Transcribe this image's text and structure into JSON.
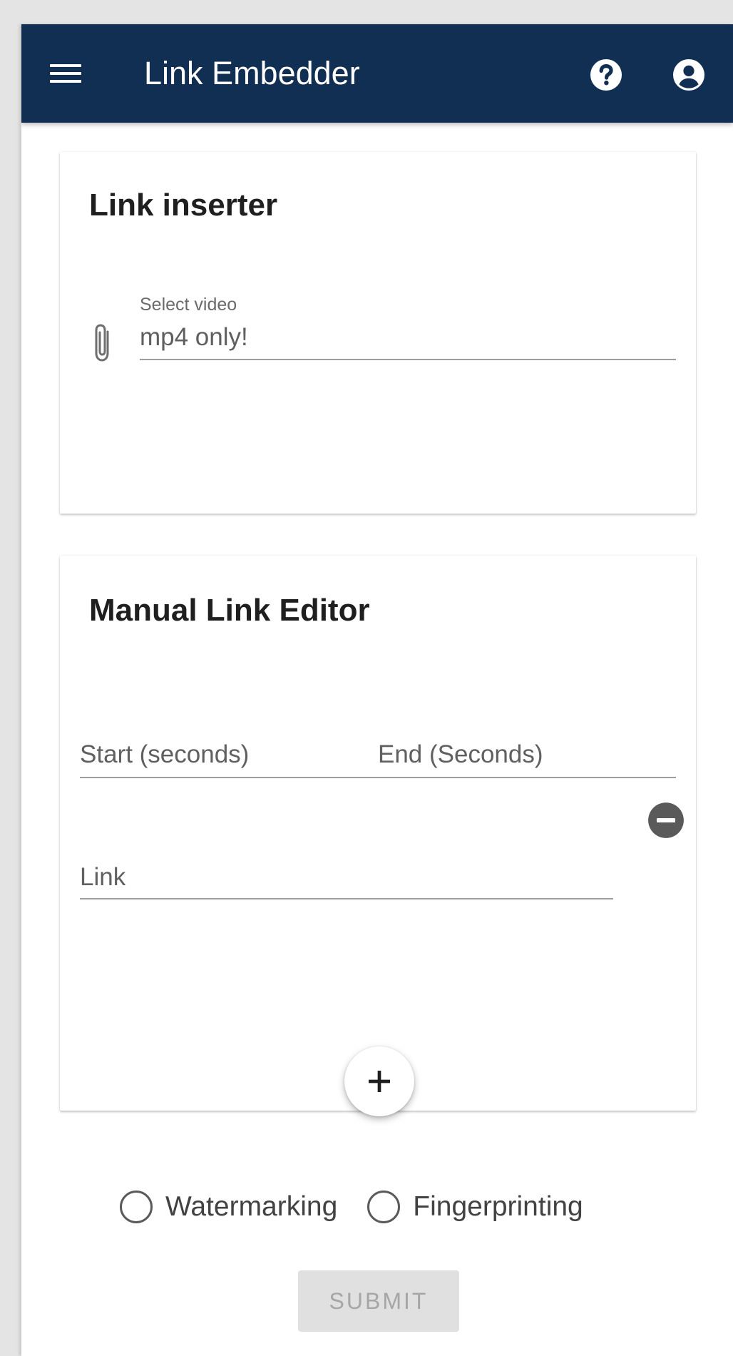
{
  "appbar": {
    "title": "Link Embedder",
    "icons": {
      "menu": "menu-icon",
      "help": "help-circle-icon",
      "account": "account-circle-icon"
    },
    "background_color": "#112f52"
  },
  "link_inserter": {
    "title": "Link inserter",
    "file_field": {
      "label": "Select video",
      "placeholder": "mp4 only!",
      "value": "",
      "icon": "paperclip-icon"
    }
  },
  "manual_link_editor": {
    "title": "Manual Link Editor",
    "entries": [
      {
        "start_placeholder": "Start (seconds)",
        "end_placeholder": "End (Seconds)",
        "link_placeholder": "Link",
        "remove_icon": "remove-circle-icon"
      }
    ],
    "add_icon": "plus-icon"
  },
  "mode": {
    "options": [
      {
        "label": "Watermarking",
        "selected": false
      },
      {
        "label": "Fingerprinting",
        "selected": false
      }
    ]
  },
  "submit": {
    "label": "SUBMIT",
    "disabled": true
  }
}
